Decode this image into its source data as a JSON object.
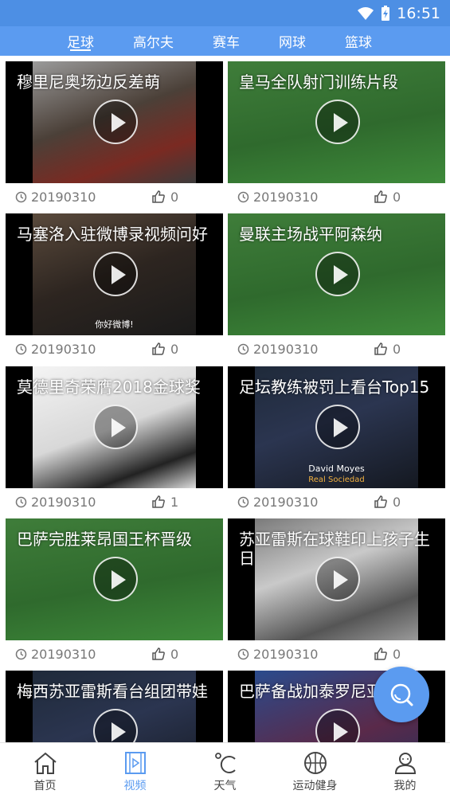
{
  "status": {
    "time": "16:51"
  },
  "tabs": [
    {
      "label": "足球",
      "active": true
    },
    {
      "label": "高尔夫",
      "active": false
    },
    {
      "label": "赛车",
      "active": false
    },
    {
      "label": "网球",
      "active": false
    },
    {
      "label": "篮球",
      "active": false
    }
  ],
  "videos": [
    {
      "title": "穆里尼奥场边反差萌",
      "date": "20190310",
      "likes": "0",
      "scene": "stairs"
    },
    {
      "title": "皇马全队射门训练片段",
      "date": "20190310",
      "likes": "0",
      "scene": "pitch"
    },
    {
      "title": "马塞洛入驻微博录视频问好",
      "date": "20190310",
      "likes": "0",
      "scene": "room",
      "caption": "你好微博!"
    },
    {
      "title": "曼联主场战平阿森纳",
      "date": "20190310",
      "likes": "0",
      "scene": "pitch"
    },
    {
      "title": "莫德里奇荣膺2018金球奖",
      "date": "20190310",
      "likes": "1",
      "scene": "white"
    },
    {
      "title": "足坛教练被罚上看台Top15",
      "date": "20190310",
      "likes": "0",
      "scene": "dark",
      "caption": "David Moyes",
      "caption2": "Real Sociedad"
    },
    {
      "title": "巴萨完胜莱昂国王杯晋级",
      "date": "20190310",
      "likes": "0",
      "scene": "pitch"
    },
    {
      "title": "苏亚雷斯在球鞋印上孩子生日",
      "date": "20190310",
      "likes": "0",
      "scene": "silver"
    },
    {
      "title": "梅西苏亚雷斯看台组团带娃",
      "date": "",
      "likes": "",
      "scene": "dark"
    },
    {
      "title": "巴萨备战加泰罗尼亚杯",
      "date": "",
      "likes": "",
      "scene": "blue"
    }
  ],
  "bottom_nav": [
    {
      "label": "首页",
      "icon": "home-icon",
      "active": false
    },
    {
      "label": "视频",
      "icon": "video-icon",
      "active": true
    },
    {
      "label": "天气",
      "icon": "weather-icon",
      "active": false
    },
    {
      "label": "运动健身",
      "icon": "basketball-icon",
      "active": false
    },
    {
      "label": "我的",
      "icon": "profile-icon",
      "active": false
    }
  ],
  "colors": {
    "primary": "#5b9bf0",
    "statusbar": "#4d8fe4",
    "muted": "#777777"
  }
}
